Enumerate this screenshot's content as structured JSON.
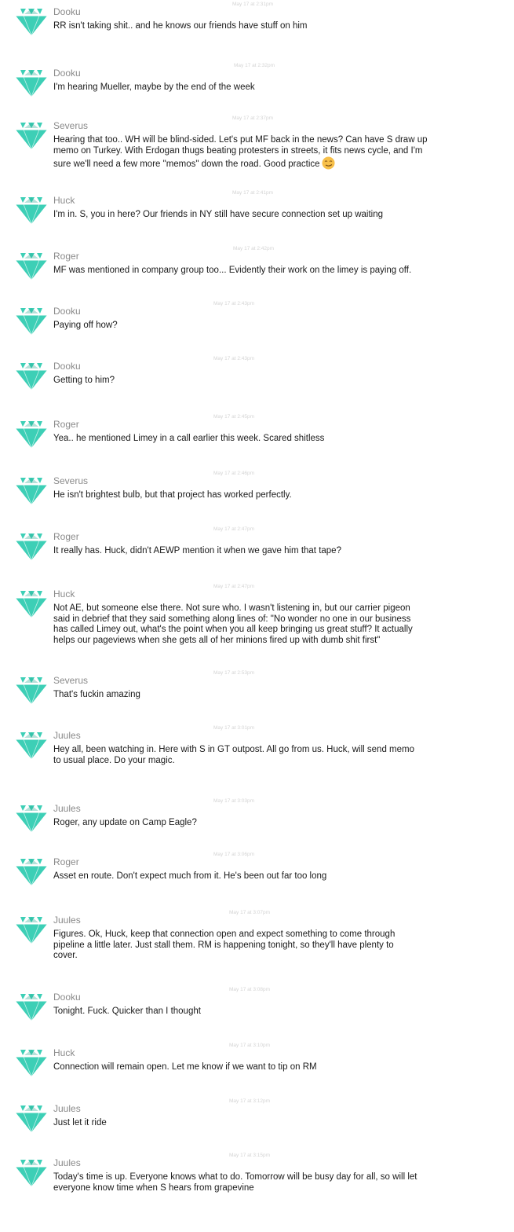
{
  "colors": {
    "avatar": "#3dcfb6",
    "avatar_dark": "#2aa893",
    "author": "#8a8a8a",
    "timestamp": "#d4d4d4",
    "text": "#1a1a1a",
    "emoji": "#f7c04a"
  },
  "icons": {
    "avatar": "diamond-icon",
    "emoji": "smirk-emoji-icon"
  },
  "messages": [
    {
      "author": "Dooku",
      "time": "May 17 at 2:31pm",
      "lines": [
        "RR isn't taking shit.. and he knows our friends have stuff on him"
      ]
    },
    {
      "author": "Dooku",
      "time": "May 17 at 2:32pm",
      "lines": [
        "I'm hearing Mueller, maybe by the end of the week"
      ]
    },
    {
      "author": "Severus",
      "time": "May 17 at 2:37pm",
      "lines": [
        "Hearing that too.. WH will be blind-sided. Let's put MF back in the news? Can have S draw up",
        "memo on Turkey. With Erdogan thugs beating protesters in streets, it fits news cycle, and I'm",
        "sure we'll need a few more \"memos\" down the road. Good practice"
      ],
      "emoji": true
    },
    {
      "author": "Huck",
      "time": "May 17 at 2:41pm",
      "lines": [
        "I'm in. S, you in here? Our friends in NY still have secure connection set up waiting"
      ]
    },
    {
      "author": "Roger",
      "time": "May 17 at 2:42pm",
      "lines": [
        "MF was mentioned in company group too... Evidently their work on the limey is paying off."
      ]
    },
    {
      "author": "Dooku",
      "time": "May 17 at 2:43pm",
      "lines": [
        "Paying off how?"
      ]
    },
    {
      "author": "Dooku",
      "time": "May 17 at 2:43pm",
      "lines": [
        "Getting to him?"
      ]
    },
    {
      "author": "Roger",
      "time": "May 17 at 2:45pm",
      "lines": [
        "Yea.. he mentioned Limey in a call earlier this week. Scared shitless"
      ]
    },
    {
      "author": "Severus",
      "time": "May 17 at 2:46pm",
      "lines": [
        "He isn't brightest bulb, but that project has worked perfectly."
      ]
    },
    {
      "author": "Roger",
      "time": "May 17 at 2:47pm",
      "lines": [
        "It really has. Huck, didn't AEWP mention it when we gave him that tape?"
      ]
    },
    {
      "author": "Huck",
      "time": "May 17 at 2:47pm",
      "lines": [
        "Not AE, but someone else there. Not sure who. I wasn't listening in, but our carrier pigeon",
        "said in debrief that they said something along lines of: \"No wonder no one in our business",
        "has called Limey out, what's the point when you all keep bringing us great stuff? It actually",
        "helps our pageviews when she gets all of her minions fired up with dumb shit first\""
      ]
    },
    {
      "author": "Severus",
      "time": "May 17 at 2:53pm",
      "lines": [
        "That's fuckin amazing"
      ]
    },
    {
      "author": "Juules",
      "time": "May 17 at 3:01pm",
      "lines": [
        "Hey all, been watching in. Here with S in GT outpost. All go from us. Huck, will send memo",
        "to usual place. Do your magic."
      ]
    },
    {
      "author": "Juules",
      "time": "May 17 at 3:03pm",
      "lines": [
        "Roger, any update on Camp Eagle?"
      ]
    },
    {
      "author": "Roger",
      "time": "May 17 at 3:06pm",
      "lines": [
        "Asset en route. Don't expect much from it. He's been out far too long"
      ]
    },
    {
      "author": "Juules",
      "time": "May 17 at 3:07pm",
      "lines": [
        "Figures. Ok, Huck, keep that connection open and expect something to come through",
        "pipeline a little later. Just stall them. RM is happening tonight, so they'll have plenty to",
        "cover."
      ]
    },
    {
      "author": "Dooku",
      "time": "May 17 at 3:08pm",
      "lines": [
        "Tonight. Fuck. Quicker than I thought"
      ]
    },
    {
      "author": "Huck",
      "time": "May 17 at 3:10pm",
      "lines": [
        "Connection will remain open. Let me know if we want to tip on RM"
      ]
    },
    {
      "author": "Juules",
      "time": "May 17 at 3:12pm",
      "lines": [
        "Just let it ride"
      ]
    },
    {
      "author": "Juules",
      "time": "May 17 at 3:15pm",
      "lines": [
        "Today's time is up. Everyone knows what to do. Tomorrow will be busy day for all, so will let",
        "everyone know time when S hears from grapevine"
      ]
    }
  ]
}
